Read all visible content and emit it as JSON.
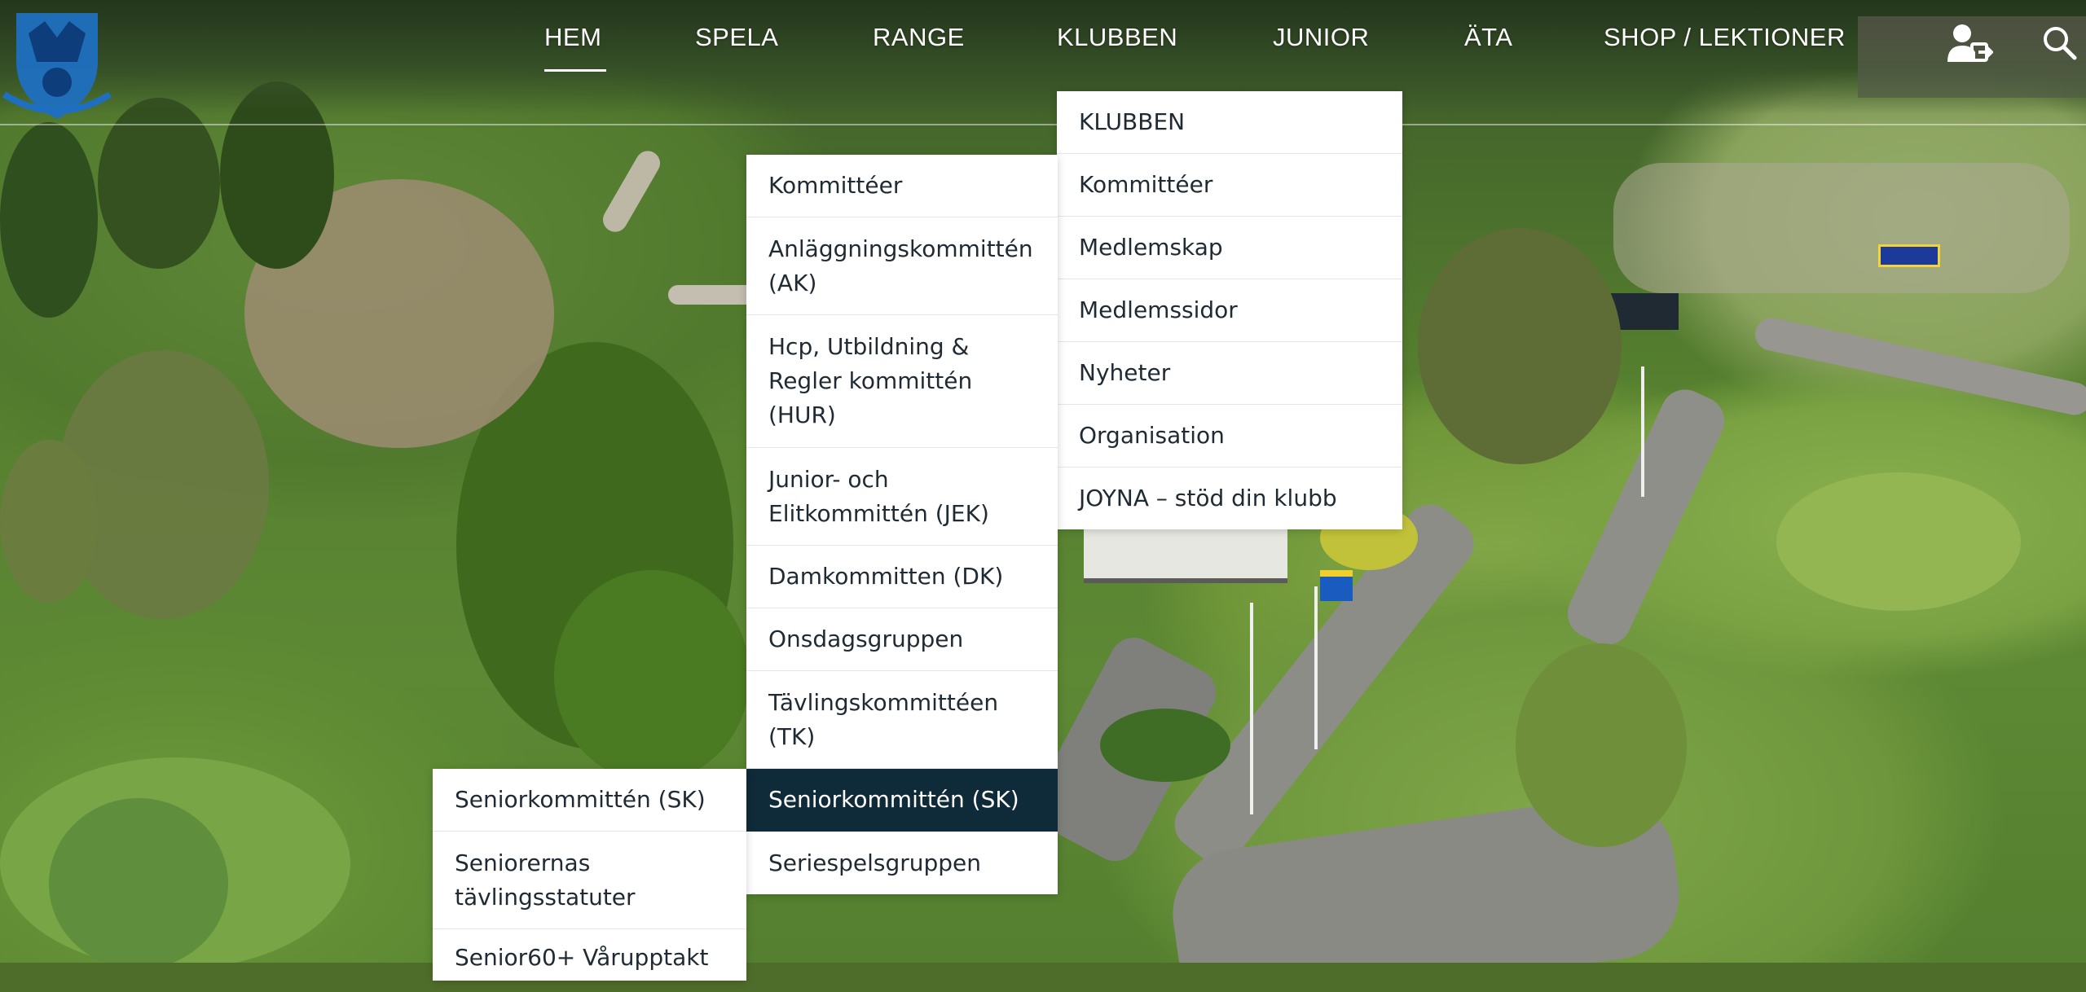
{
  "nav": {
    "items": [
      "HEM",
      "SPELA",
      "RANGE",
      "KLUBBEN",
      "JUNIOR",
      "ÄTA",
      "SHOP / LEKTIONER"
    ],
    "active": "HEM"
  },
  "icons": {
    "logo": "club-crest-logo",
    "user": "user-login-icon",
    "search": "search-icon"
  },
  "klubben_menu": {
    "items": [
      "KLUBBEN",
      "Kommittéer",
      "Medlemskap",
      "Medlemssidor",
      "Nyheter",
      "Organisation",
      "JOYNA – stöd din klubb"
    ]
  },
  "kommitteer_menu": {
    "items": [
      "Kommittéer",
      "Anläggningskommittén (AK)",
      "Hcp, Utbildning & Regler kommittén (HUR)",
      "Junior- och Elitkommittén (JEK)",
      "Damkommitten (DK)",
      "Onsdagsgruppen",
      "Tävlingskommittéen (TK)",
      "Seniorkommittén (SK)",
      "Seriespelsgruppen"
    ],
    "active": "Seniorkommittén (SK)"
  },
  "senior_menu": {
    "items": [
      "Seniorkommittén (SK)",
      "Seniorernas tävlingsstatuter",
      "Senior60+ Vårupptakt"
    ]
  },
  "colors": {
    "active_menu_bg": "#0f2a38",
    "menu_text": "#1f2a33",
    "logo_blue": "#1f6fc0"
  }
}
